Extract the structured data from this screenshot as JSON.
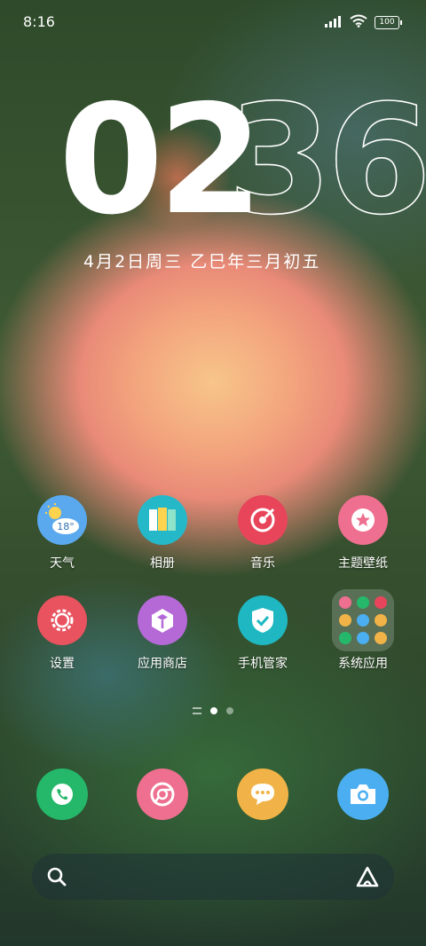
{
  "status_bar": {
    "time": "8:16",
    "signal_icon": "signal-icon",
    "wifi_icon": "wifi-icon",
    "battery": "100"
  },
  "clock": {
    "hour": "02",
    "minute": "36",
    "date": "4月2日周三 乙巳年三月初五"
  },
  "apps": [
    {
      "label": "天气",
      "icon": "weather-icon",
      "temp": "18°",
      "color": "#5aa9ee"
    },
    {
      "label": "相册",
      "icon": "gallery-icon",
      "color": "#25b8c9"
    },
    {
      "label": "音乐",
      "icon": "music-icon",
      "color": "#e8455a"
    },
    {
      "label": "主题壁纸",
      "icon": "theme-icon",
      "color": "#ee6f8f"
    },
    {
      "label": "设置",
      "icon": "settings-icon",
      "color": "#e8535f"
    },
    {
      "label": "应用商店",
      "icon": "app-store-icon",
      "color": "#b569d6"
    },
    {
      "label": "手机管家",
      "icon": "security-icon",
      "color": "#1fb8c2"
    },
    {
      "label": "系统应用",
      "icon": "folder-icon",
      "color": "#6b7f6a"
    }
  ],
  "dock": [
    {
      "name": "phone",
      "icon": "phone-icon",
      "color": "#25b86a"
    },
    {
      "name": "browser",
      "icon": "browser-icon",
      "color": "#ee6f8f"
    },
    {
      "name": "messages",
      "icon": "message-icon",
      "color": "#f1b347"
    },
    {
      "name": "camera",
      "icon": "camera-icon",
      "color": "#4aaef0"
    }
  ],
  "search_bar": {
    "search_icon": "search-icon",
    "assistant_icon": "assistant-icon"
  },
  "pager": {
    "pages": 2,
    "active": 1
  }
}
